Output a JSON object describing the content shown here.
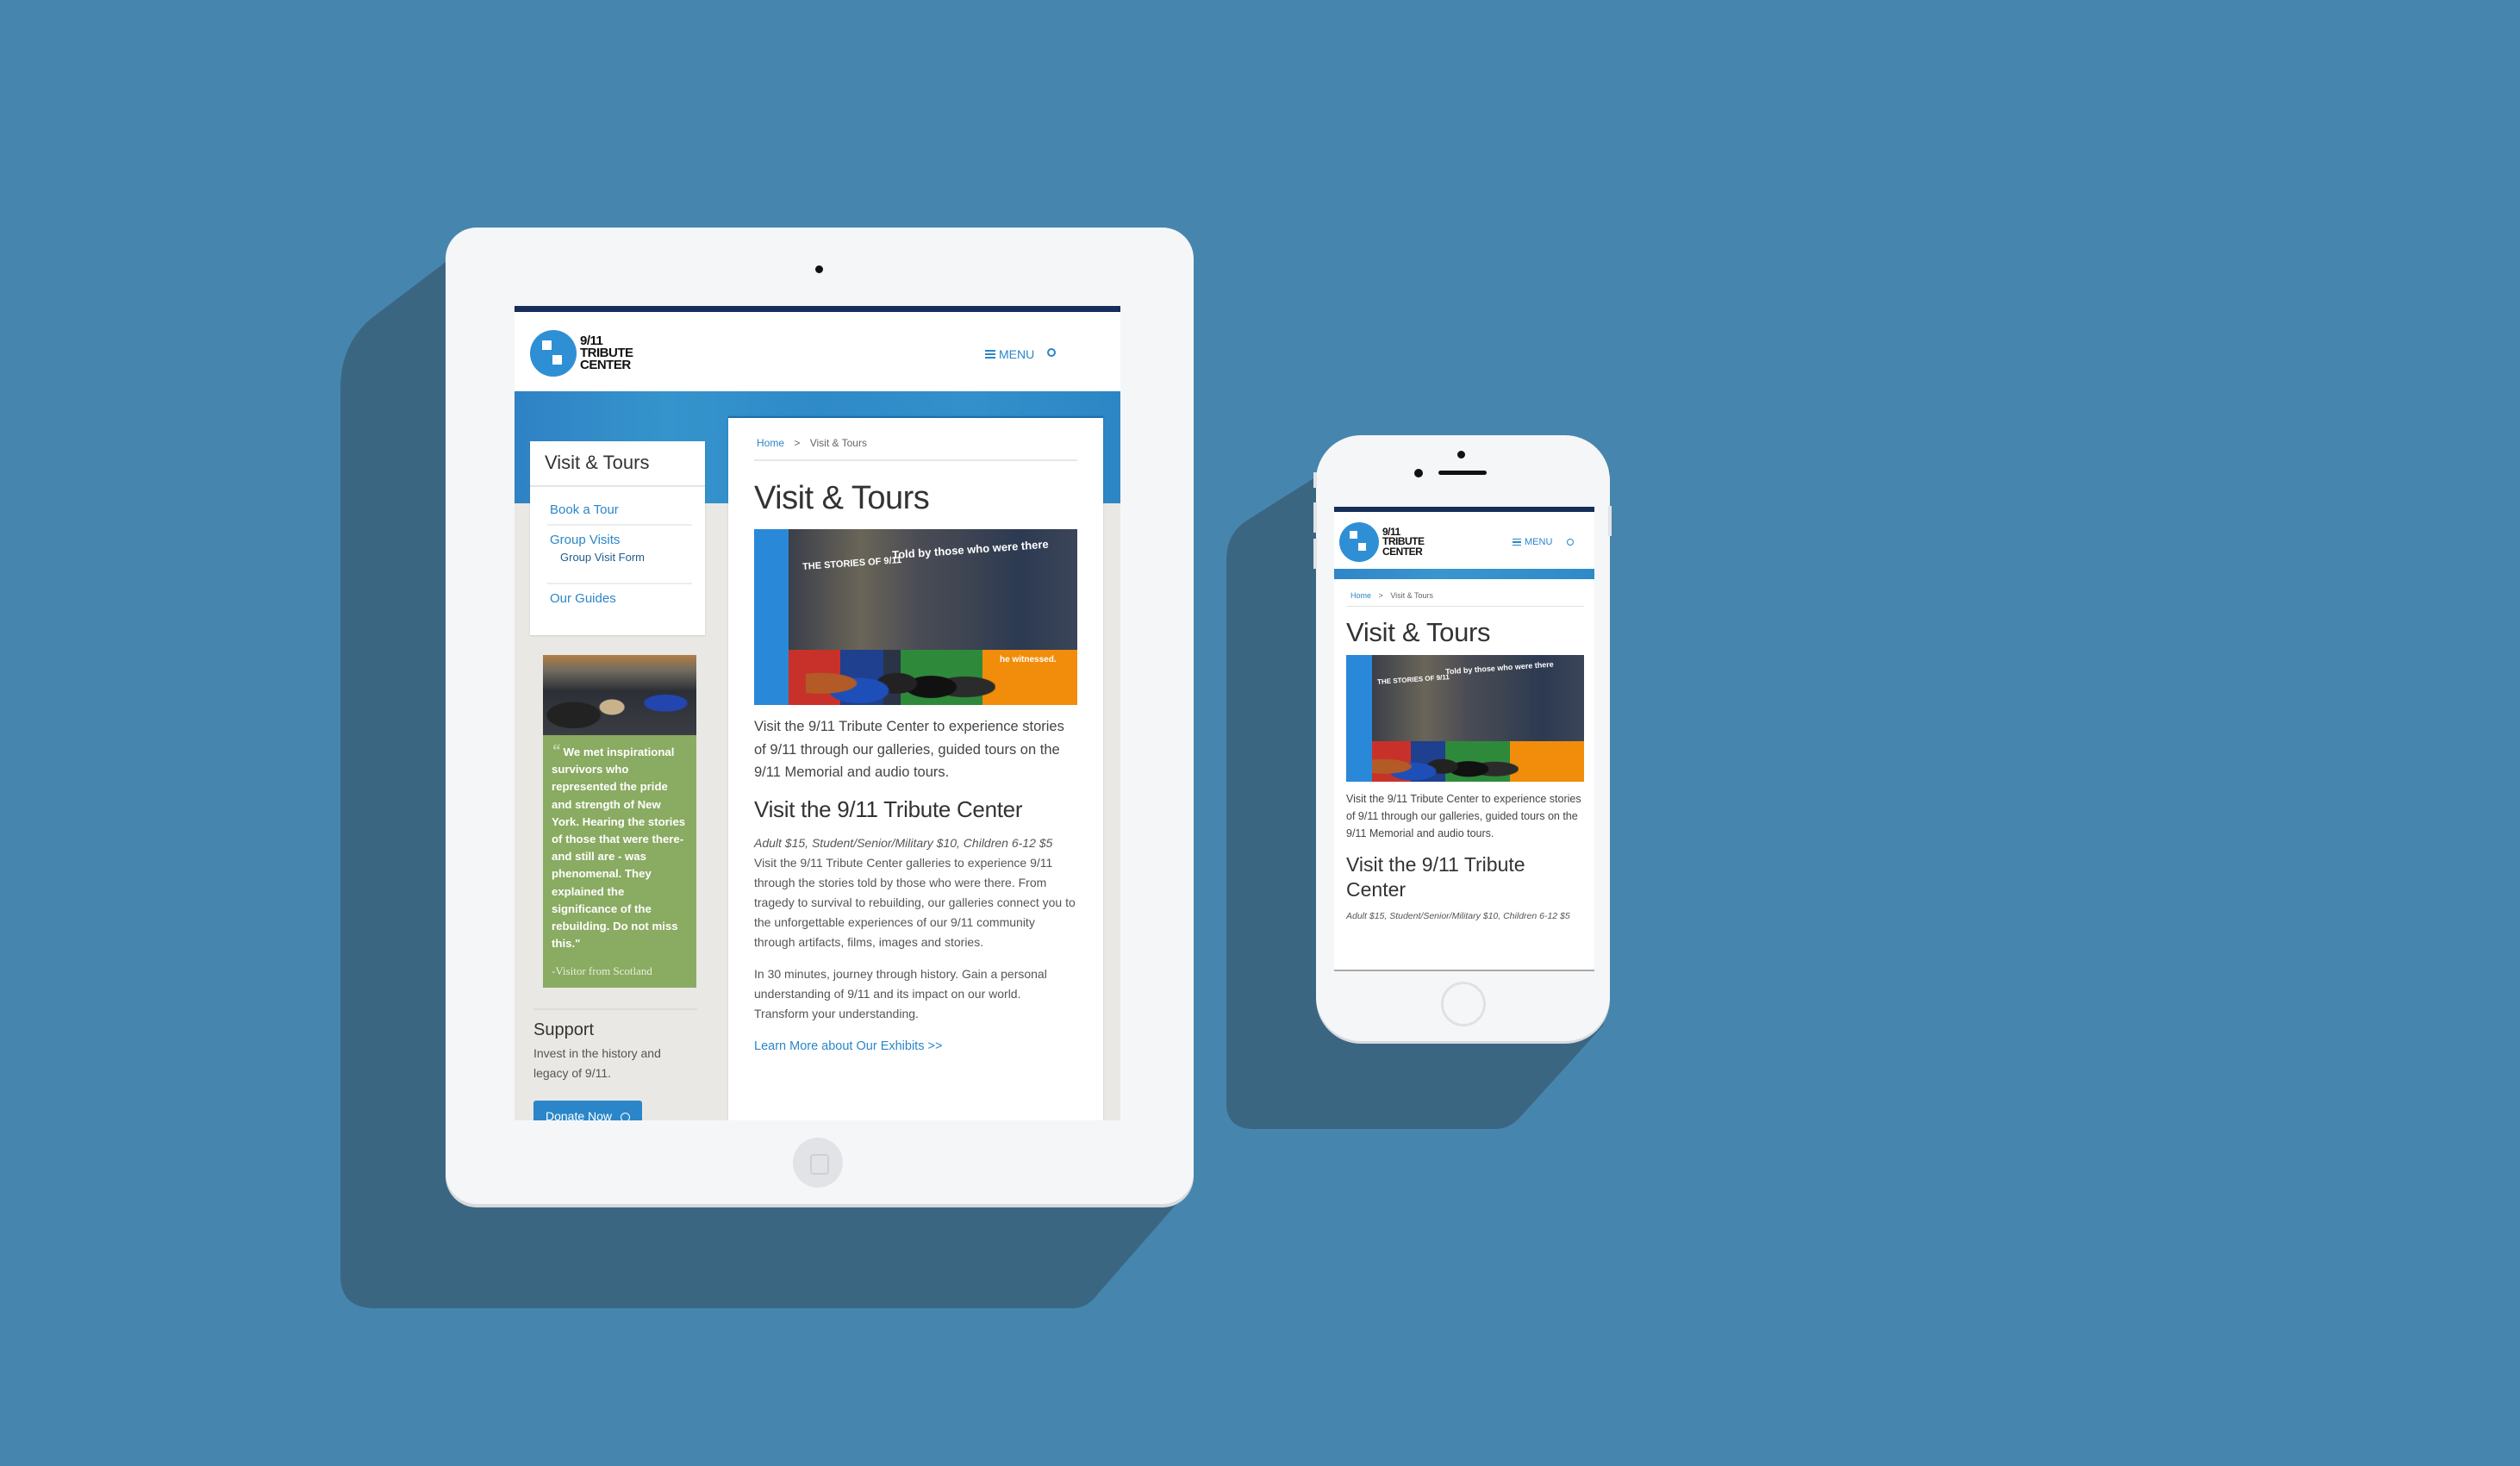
{
  "colors": {
    "background": "#4686ae",
    "shadow": "#3b6682",
    "device_body": "#f5f6f8",
    "brand_navy": "#172d5a",
    "brand_blue": "#2a86c8",
    "testimonial_green": "#8aab62"
  },
  "site": {
    "logo": {
      "line1": "9/11",
      "line2": "TRIBUTE",
      "line3": "CENTER",
      "icon": "tribute-logo-icon"
    },
    "menu_label": "MENU",
    "menu_icon": "hamburger-icon",
    "search_icon": "search-icon"
  },
  "tablet": {
    "sidenav": {
      "title": "Visit & Tours",
      "items": [
        {
          "label": "Book a Tour"
        },
        {
          "label": "Group Visits",
          "subitems": [
            {
              "label": "Group Visit Form"
            }
          ]
        },
        {
          "label": "Our Guides"
        }
      ]
    },
    "testimonial": {
      "quote_mark": "“",
      "text": "We met inspirational survivors who represented the pride and strength of New York. Hearing the stories of those that were there- and still are - was phenomenal. They explained the significance of the rebuilding. Do not miss this.\"",
      "attribution": "-Visitor from Scotland"
    },
    "support": {
      "title": "Support",
      "text": "Invest in the history and legacy of 9/11.",
      "button_label": "Donate Now",
      "button_icon": "circle-arrow-icon"
    }
  },
  "page": {
    "breadcrumb": {
      "home": "Home",
      "separator": ">",
      "current": "Visit & Tours"
    },
    "title": "Visit & Tours",
    "hero_captions": {
      "left": "THE STORIES OF 9/11",
      "right": "Told by those who were there",
      "band": "he witnessed."
    },
    "lead": "Visit the 9/11 Tribute Center to experience stories of 9/11 through our galleries, guided tours on the 9/11 Memorial and audio tours.",
    "section_title": "Visit the 9/11 Tribute Center",
    "prices": "Adult $15, Student/Senior/Military $10, Children 6-12 $5",
    "body1": "Visit the 9/11 Tribute Center galleries to experience 9/11 through the stories told by those who were there. From tragedy to survival to rebuilding, our galleries connect you to the unforgettable experiences of our 9/11 community through artifacts, films, images and stories.",
    "body2": "In 30 minutes, journey through history. Gain a personal understanding of 9/11 and its impact on our world. Transform your understanding.",
    "more_link": "Learn More about Our Exhibits >>"
  }
}
